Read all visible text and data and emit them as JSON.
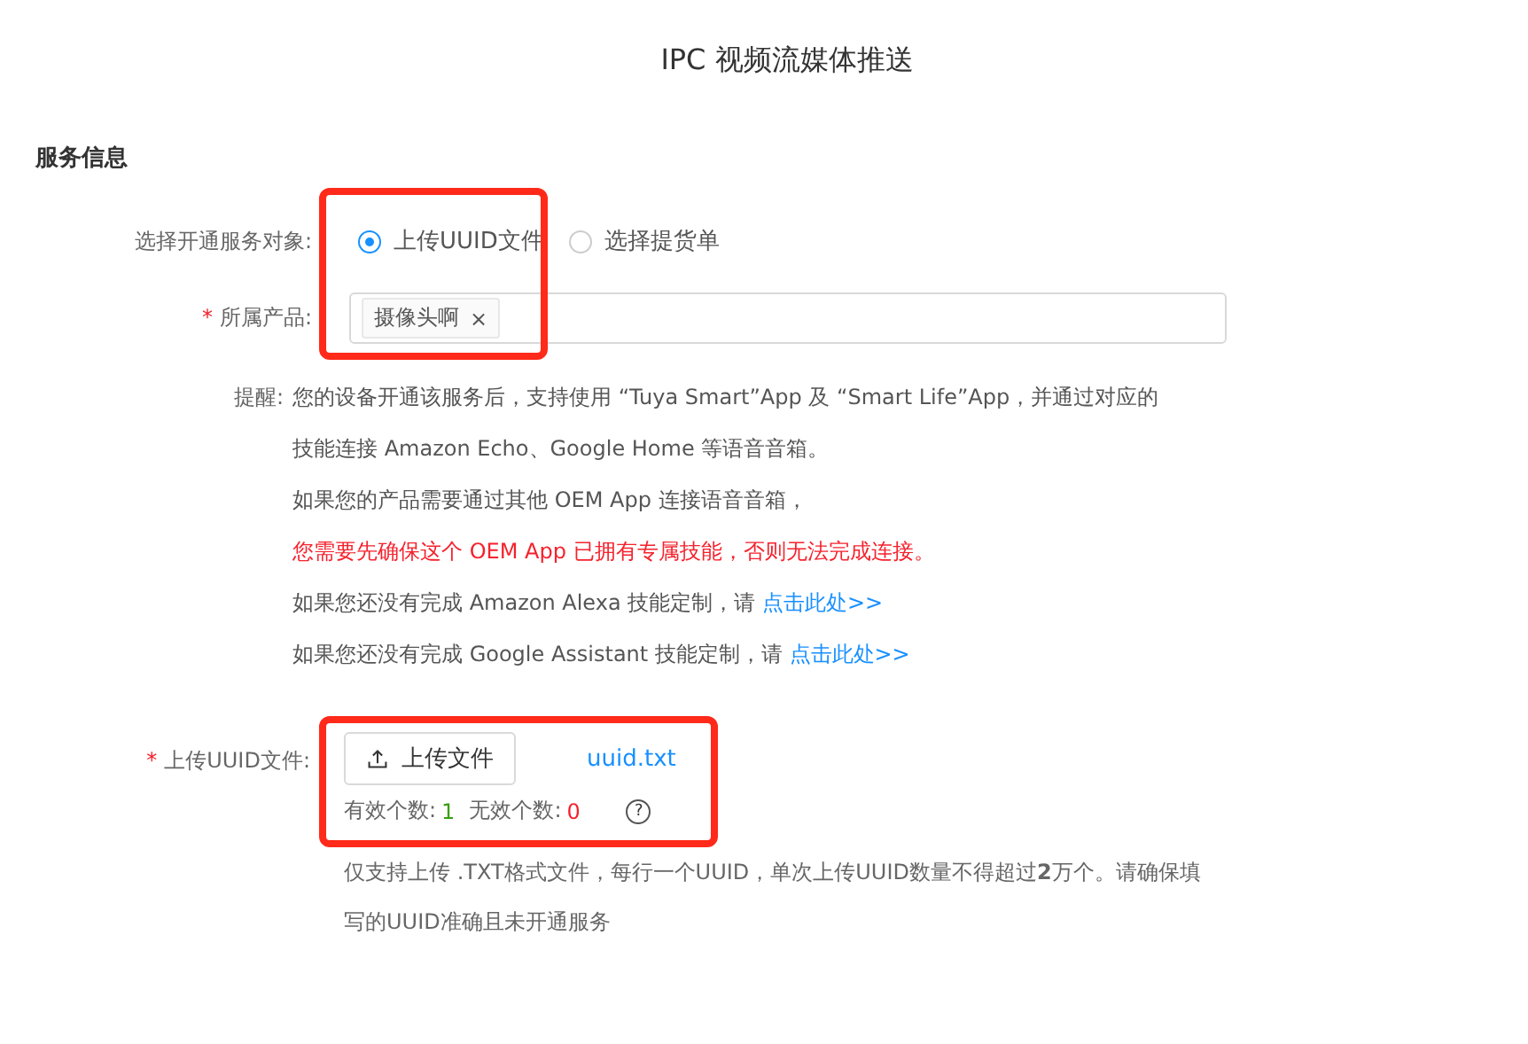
{
  "page_title": "IPC 视频流媒体推送",
  "section_title": "服务信息",
  "service_target": {
    "label": "选择开通服务对象:",
    "options": [
      {
        "label": "上传UUID文件",
        "selected": true
      },
      {
        "label": "选择提货单",
        "selected": false
      }
    ]
  },
  "product": {
    "required_mark": "*",
    "label": "所属产品:",
    "tags": [
      {
        "label": "摄像头啊",
        "remove": "×"
      }
    ]
  },
  "reminder": {
    "label": "提醒:",
    "lines": [
      {
        "kind": "normal",
        "text": "您的设备开通该服务后，支持使用 “Tuya Smart”App 及 “Smart Life”App，并通过对应的"
      },
      {
        "kind": "normal",
        "text": "技能连接 Amazon Echo、Google Home 等语音音箱。"
      },
      {
        "kind": "normal",
        "text": "如果您的产品需要通过其他 OEM App 连接语音音箱，"
      },
      {
        "kind": "warning",
        "text": "您需要先确保这个 OEM App 已拥有专属技能，否则无法完成连接。"
      },
      {
        "kind": "link",
        "text": "如果您还没有完成 Amazon Alexa 技能定制，请 ",
        "link": "点击此处>>"
      },
      {
        "kind": "link",
        "text": "如果您还没有完成 Google Assistant 技能定制，请 ",
        "link": "点击此处>>"
      }
    ]
  },
  "upload": {
    "required_mark": "*",
    "label": "上传UUID文件:",
    "button": "上传文件",
    "file_name": "uuid.txt",
    "valid_label": "有效个数:",
    "valid_count": "1",
    "invalid_label": "无效个数:",
    "invalid_count": "0",
    "help": "?",
    "note": "仅支持上传 .TXT格式文件，每行一个UUID，单次上传UUID数量不得超过**2**万个。请确保填写的UUID准确且未开通服务"
  }
}
